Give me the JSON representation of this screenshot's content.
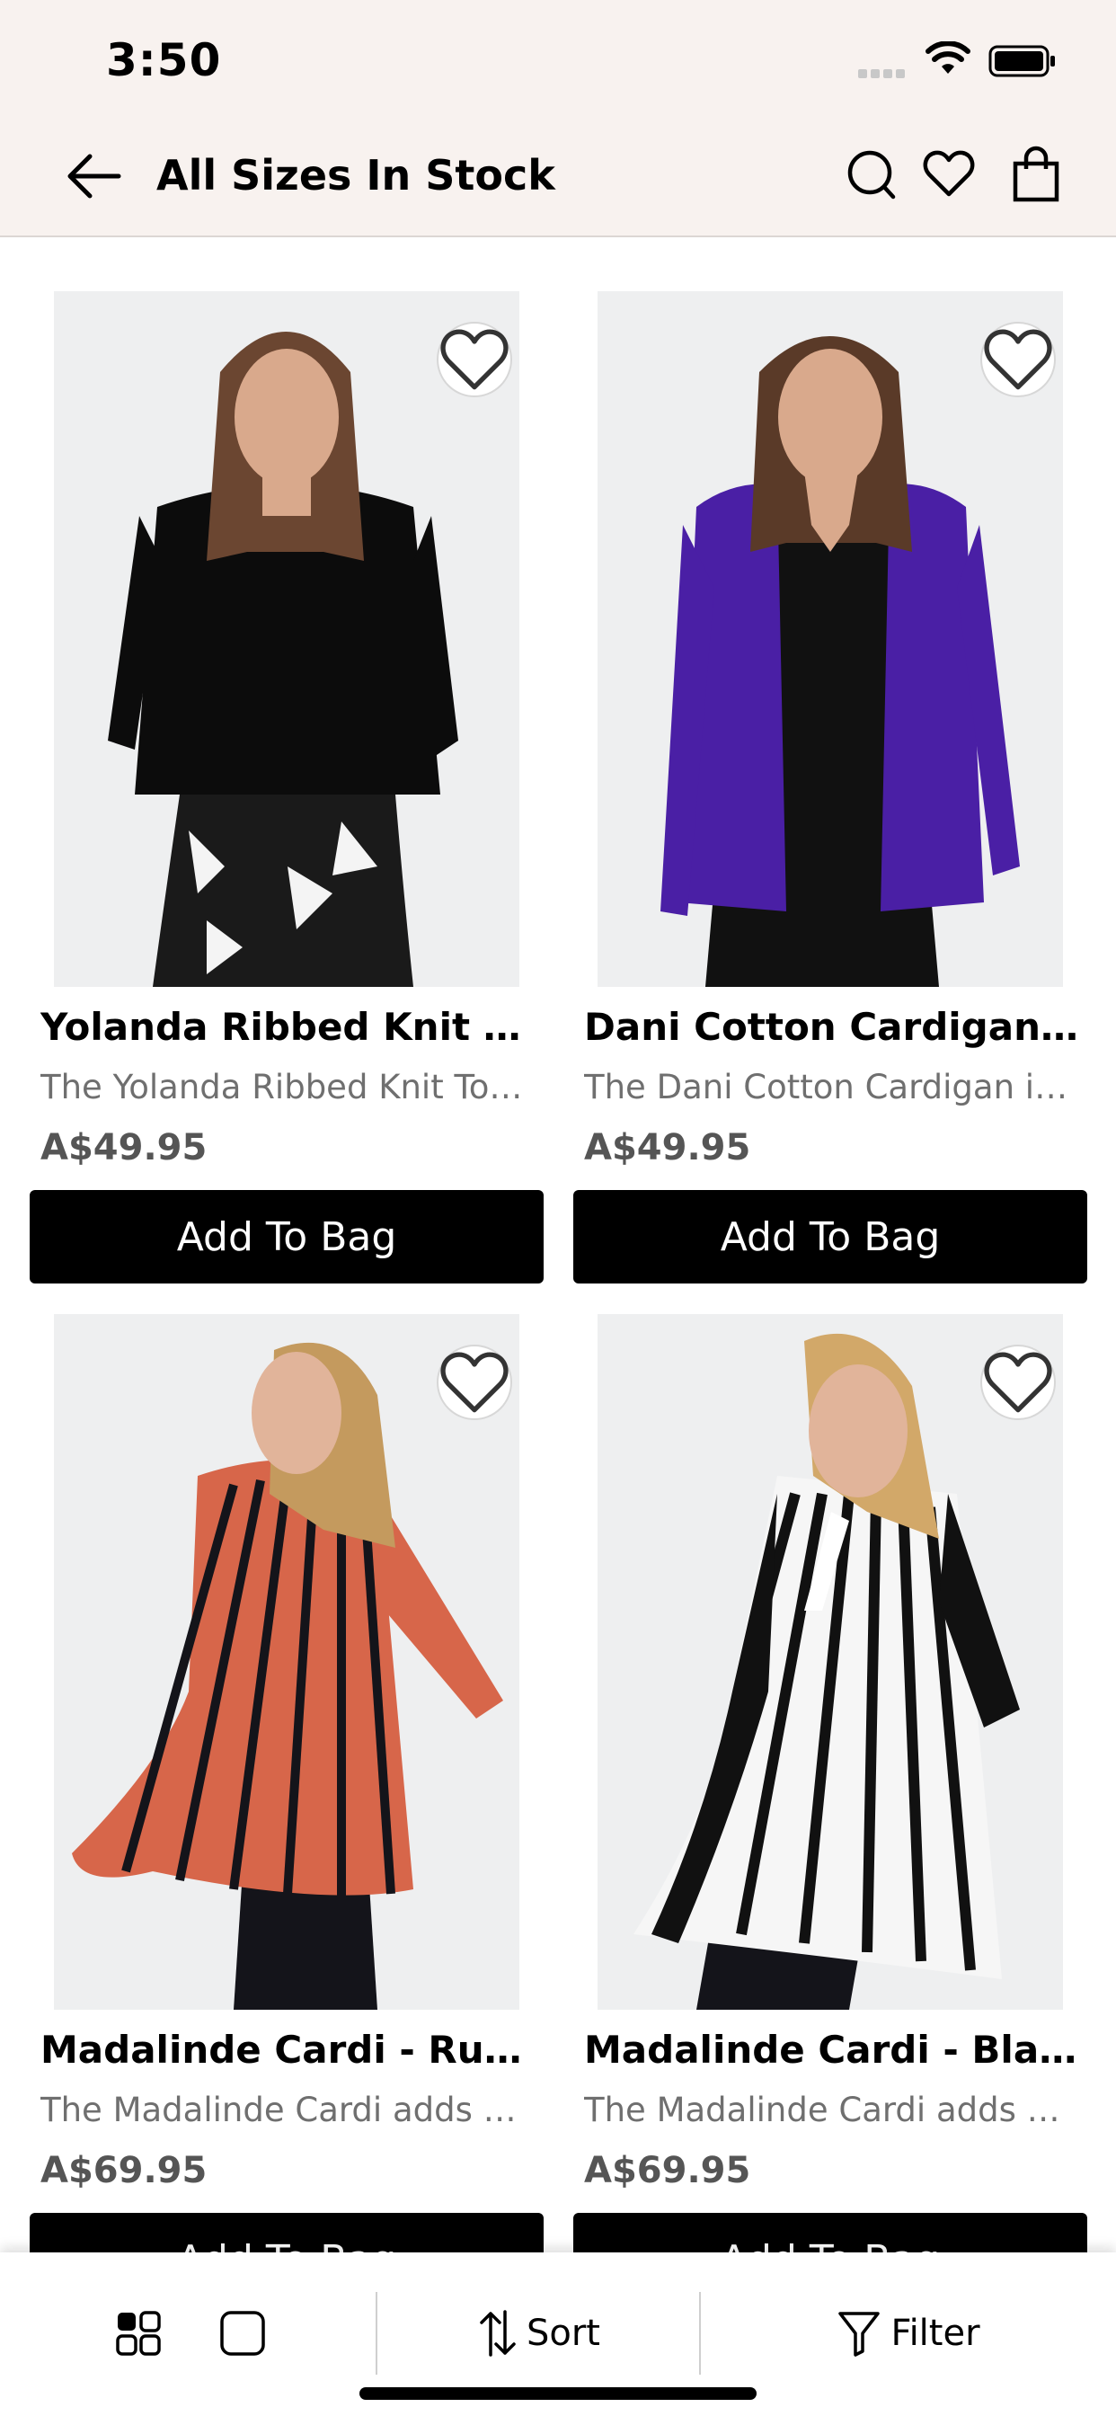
{
  "status_bar": {
    "time": "3:50"
  },
  "header": {
    "title": "All Sizes In Stock"
  },
  "products": [
    {
      "name": "Yolanda Ribbed Knit Top - Black",
      "description": "The Yolanda Ribbed Knit Top is the perfect layering piece",
      "price": "A$49.95",
      "button": "Add To Bag",
      "image_colors": {
        "top": "#0c0c0c",
        "pants": "#1a1a1a",
        "skin": "#d9a98c",
        "hair": "#6b4631"
      }
    },
    {
      "name": "Dani Cotton Cardigan - Purple",
      "description": "The Dani Cotton Cardigan is a wardrobe essential",
      "price": "A$49.95",
      "button": "Add To Bag",
      "image_colors": {
        "top": "#4a1fa5",
        "pants": "#111111",
        "skin": "#d9a98c",
        "hair": "#5a3a28"
      }
    },
    {
      "name": "Madalinde Cardi - Rust/Black",
      "description": "The Madalinde Cardi adds a pop of colour",
      "price": "A$69.95",
      "button": "Add To Bag",
      "image_colors": {
        "top": "#d7664a",
        "pants": "#14141a",
        "skin": "#e1b49a",
        "hair": "#c49a5e"
      }
    },
    {
      "name": "Madalinde Cardi - Black/White",
      "description": "The Madalinde Cardi adds a classic touch",
      "price": "A$69.95",
      "button": "Add To Bag",
      "image_colors": {
        "top": "#111111",
        "pants": "#14141a",
        "skin": "#e1b49a",
        "hair": "#d2a869"
      }
    }
  ],
  "bottom_bar": {
    "sort_label": "Sort",
    "filter_label": "Filter"
  }
}
